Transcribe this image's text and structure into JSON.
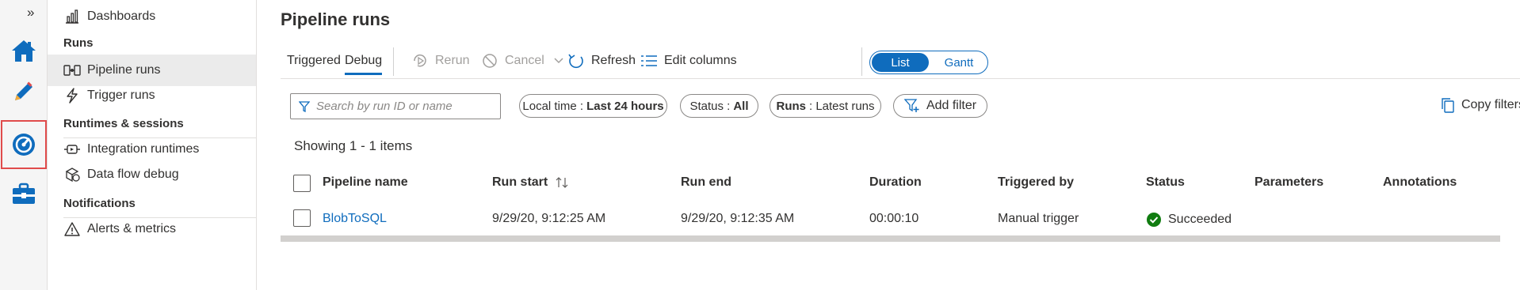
{
  "rail": {
    "expand_glyph": "»",
    "icons": [
      "home-icon",
      "author-pencil-icon",
      "monitor-gauge-icon",
      "manage-toolbox-icon"
    ]
  },
  "nav": {
    "dashboards": "Dashboards",
    "section_runs": "Runs",
    "pipeline_runs": "Pipeline runs",
    "trigger_runs": "Trigger runs",
    "section_runtimes": "Runtimes & sessions",
    "integration_runtimes": "Integration runtimes",
    "data_flow_debug": "Data flow debug",
    "section_notifications": "Notifications",
    "alerts_metrics": "Alerts & metrics"
  },
  "page": {
    "title": "Pipeline runs"
  },
  "toolbar": {
    "tab_triggered": "Triggered",
    "tab_debug": "Debug",
    "rerun": "Rerun",
    "cancel": "Cancel",
    "refresh": "Refresh",
    "edit_columns": "Edit columns",
    "view_list": "List",
    "view_gantt": "Gantt"
  },
  "filters": {
    "search_placeholder": "Search by run ID or name",
    "time_label": "Local time : ",
    "time_value": "Last 24 hours",
    "status_label": "Status : ",
    "status_value": "All",
    "runs_label": "Runs",
    "runs_value": " : Latest runs",
    "add_filter": "Add filter",
    "copy_filters": "Copy filters"
  },
  "summary": {
    "showing": "Showing 1 - 1 items"
  },
  "table": {
    "columns": {
      "pipeline_name": "Pipeline name",
      "run_start": "Run start",
      "run_end": "Run end",
      "duration": "Duration",
      "triggered_by": "Triggered by",
      "status": "Status",
      "parameters": "Parameters",
      "annotations": "Annotations"
    },
    "rows": [
      {
        "pipeline_name": "BlobToSQL",
        "run_start": "9/29/20, 9:12:25 AM",
        "run_end": "9/29/20, 9:12:35 AM",
        "duration": "00:00:10",
        "triggered_by": "Manual trigger",
        "status": "Succeeded",
        "parameters": "",
        "annotations": ""
      }
    ]
  },
  "colors": {
    "accent": "#0f6cbd",
    "success": "#107c10",
    "highlight": "#e04b4b"
  }
}
